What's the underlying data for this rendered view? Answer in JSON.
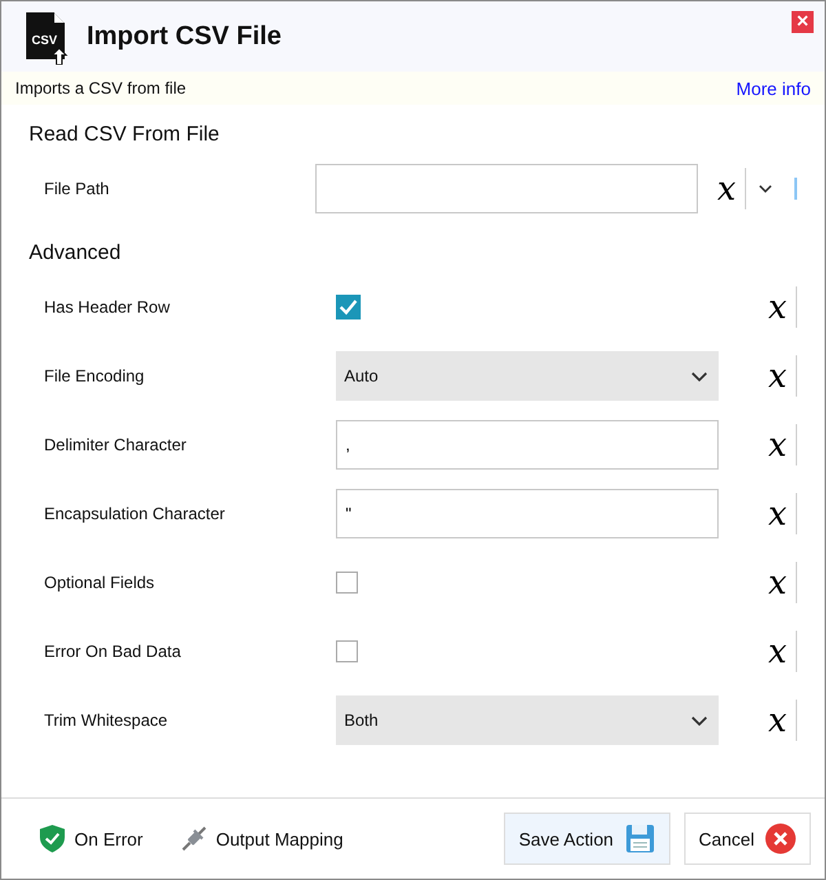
{
  "window": {
    "title": "Import CSV File",
    "icon_text": "CSV",
    "close": "×"
  },
  "info_bar": {
    "description": "Imports a CSV from file",
    "link": "More info"
  },
  "sections": [
    {
      "title": "Read CSV From File",
      "fields": [
        {
          "kind": "path",
          "label": "File Path",
          "variable": "x"
        }
      ]
    },
    {
      "title": "Advanced",
      "fields": [
        {
          "kind": "checkbox",
          "label": "Has Header Row",
          "checked": true,
          "variable": "x"
        },
        {
          "kind": "select",
          "label": "File Encoding",
          "value": "Auto",
          "variable": "x"
        },
        {
          "kind": "text",
          "label": "Delimiter Character",
          "value": ",",
          "variable": "x"
        },
        {
          "kind": "text",
          "label": "Encapsulation Character",
          "value": "\"",
          "variable": "x"
        },
        {
          "kind": "checkbox",
          "label": "Optional Fields",
          "checked": false,
          "variable": "x"
        },
        {
          "kind": "checkbox",
          "label": "Error On Bad Data",
          "checked": false,
          "variable": "x"
        },
        {
          "kind": "select",
          "label": "Trim Whitespace",
          "value": "Both",
          "variable": "x"
        }
      ]
    }
  ],
  "footer": {
    "links": [
      "On Error",
      "Output Mapping"
    ],
    "save": "Save Action",
    "cancel": "Cancel"
  }
}
